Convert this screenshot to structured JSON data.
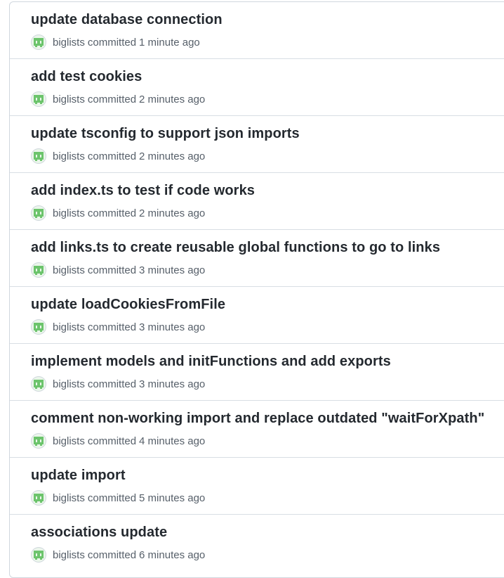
{
  "commits": [
    {
      "title": "update database connection",
      "author": "biglists",
      "verb": "committed",
      "time": "1 minute ago"
    },
    {
      "title": "add test cookies",
      "author": "biglists",
      "verb": "committed",
      "time": "2 minutes ago"
    },
    {
      "title": "update tsconfig to support json imports",
      "author": "biglists",
      "verb": "committed",
      "time": "2 minutes ago"
    },
    {
      "title": "add index.ts to test if code works",
      "author": "biglists",
      "verb": "committed",
      "time": "2 minutes ago"
    },
    {
      "title": "add links.ts to create reusable global functions to go to links",
      "author": "biglists",
      "verb": "committed",
      "time": "3 minutes ago"
    },
    {
      "title": "update loadCookiesFromFile",
      "author": "biglists",
      "verb": "committed",
      "time": "3 minutes ago"
    },
    {
      "title": "implement models and initFunctions and add exports",
      "author": "biglists",
      "verb": "committed",
      "time": "3 minutes ago"
    },
    {
      "title": "comment non-working import and replace outdated \"waitForXpath\"",
      "author": "biglists",
      "verb": "committed",
      "time": "4 minutes ago"
    },
    {
      "title": "update import",
      "author": "biglists",
      "verb": "committed",
      "time": "5 minutes ago"
    },
    {
      "title": "associations update",
      "author": "biglists",
      "verb": "committed",
      "time": "6 minutes ago"
    }
  ],
  "colors": {
    "avatar_green": "#6cc46c",
    "avatar_bg": "#eaf6ea",
    "title": "#24292f",
    "meta": "#57606a",
    "border": "#d8dee4"
  },
  "icons": {
    "avatar": "identicon-avatar"
  }
}
